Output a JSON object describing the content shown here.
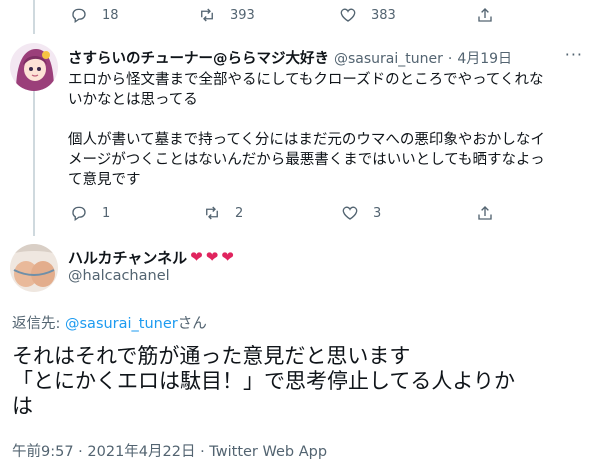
{
  "top_actions": {
    "reply_count": "18",
    "retweet_count": "393",
    "like_count": "383"
  },
  "reply_tweet": {
    "name": "さすらいのチューナー@ららマジ大好き",
    "handle": "@sasurai_tuner",
    "separator": "·",
    "date": "4月19日",
    "more": "···",
    "text": "エロから怪文書まで全部やるにしてもクローズドのところでやってくれな\nいかなとは思ってる\n\n個人が書いて墓まで持ってく分にはまだ元のウマへの悪印象やおかしなイ\nメージがつくことはないんだから最悪書くまではいいとしても晒すなよっ\nて意見です",
    "reply_count": "1",
    "retweet_count": "2",
    "like_count": "3"
  },
  "main_tweet": {
    "name": "ハルカチャンネル",
    "hearts": [
      "❤",
      "❤",
      "❤"
    ],
    "handle": "@halcachanel",
    "reply_prefix": "返信先: ",
    "reply_mention": "@sasurai_tuner",
    "reply_suffix": "さん",
    "text": "それはそれで筋が通った意見だと思います\n「とにかくエロは駄目！」で思考停止してる人よりか\nは",
    "meta": "午前9:57 · 2021年4月22日 · Twitter Web App"
  },
  "colors": {
    "accent": "#1d9bf0",
    "muted": "#536471",
    "heart": "#e0245e",
    "thread": "#cfd9de"
  },
  "icons": [
    "reply-icon",
    "retweet-icon",
    "like-icon",
    "share-icon",
    "heart-emoji"
  ]
}
